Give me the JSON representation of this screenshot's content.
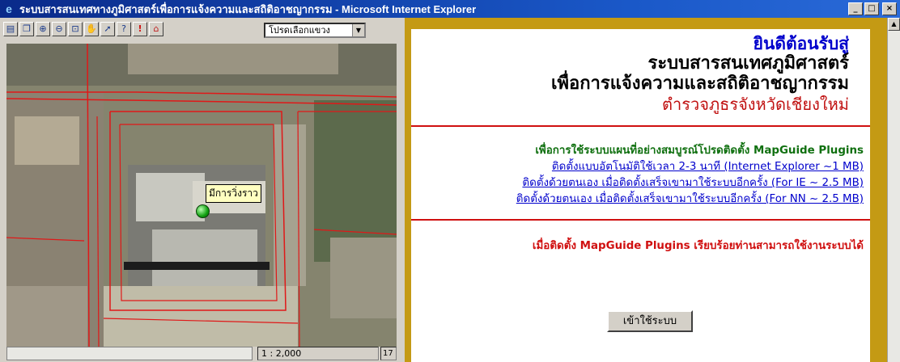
{
  "window": {
    "title": "ระบบสารสนเทศทางภูมิศาสตร์เพื่อการแจ้งความและสถิติอาชญากรรม - Microsoft Internet Explorer",
    "buttons": {
      "minimize": "_",
      "maximize": "□",
      "close": "×"
    }
  },
  "toolbar": {
    "tools": [
      {
        "icon": "print-icon",
        "glyph": "▤"
      },
      {
        "icon": "copy-icon",
        "glyph": "❐"
      },
      {
        "icon": "zoom-in-icon",
        "glyph": "⊕"
      },
      {
        "icon": "zoom-out-icon",
        "glyph": "⊖"
      },
      {
        "icon": "zoom-window-icon",
        "glyph": "⊡"
      },
      {
        "icon": "pan-hand-icon",
        "glyph": "✋"
      },
      {
        "icon": "select-arrow-icon",
        "glyph": "➚"
      },
      {
        "icon": "help-icon",
        "glyph": "?"
      },
      {
        "icon": "alert-icon",
        "glyph": "!"
      },
      {
        "icon": "home-icon",
        "glyph": "⌂"
      }
    ],
    "layer_select": "โปรดเลือกแขวง"
  },
  "map": {
    "marker_label": "มีการวิ่งราว",
    "scale": "1 : 2,000",
    "extra_status": "17"
  },
  "welcome": {
    "line1": "ยินดีต้อนรับสู่",
    "line2": "ระบบสารสนเทศภูมิศาสตร์",
    "line3": "เพื่อการแจ้งความและสถิติอาชญากรรม",
    "line4": "ตำรวจภูธรจังหวัดเชียงใหม่"
  },
  "install": {
    "heading": "เพื่อการใช้ระบบแผนที่อย่างสมบูรณ์โปรดติดตั้ง MapGuide Plugins",
    "links": [
      "ติดตั้งแบบอัตโนมัติใช้เวลา 2-3 นาที (Internet Explorer ~1 MB)",
      "ติดตั้งด้วยตนเอง เมื่อติดตั้งเสร็จเขามาใช้ระบบอีกครั้ง (For IE ~ 2.5 MB)",
      "ติดตั้งด้วยตนเอง เมื่อติดตั้งเสร็จเขามาใช้ระบบอีกครั้ง (For NN ~ 2.5 MB)"
    ]
  },
  "done": {
    "message": "เมื่อติดตั้ง MapGuide Plugins เรียบร้อยท่านสามารถใช้งานระบบได้",
    "button": "เข้าใช้ระบบ"
  }
}
